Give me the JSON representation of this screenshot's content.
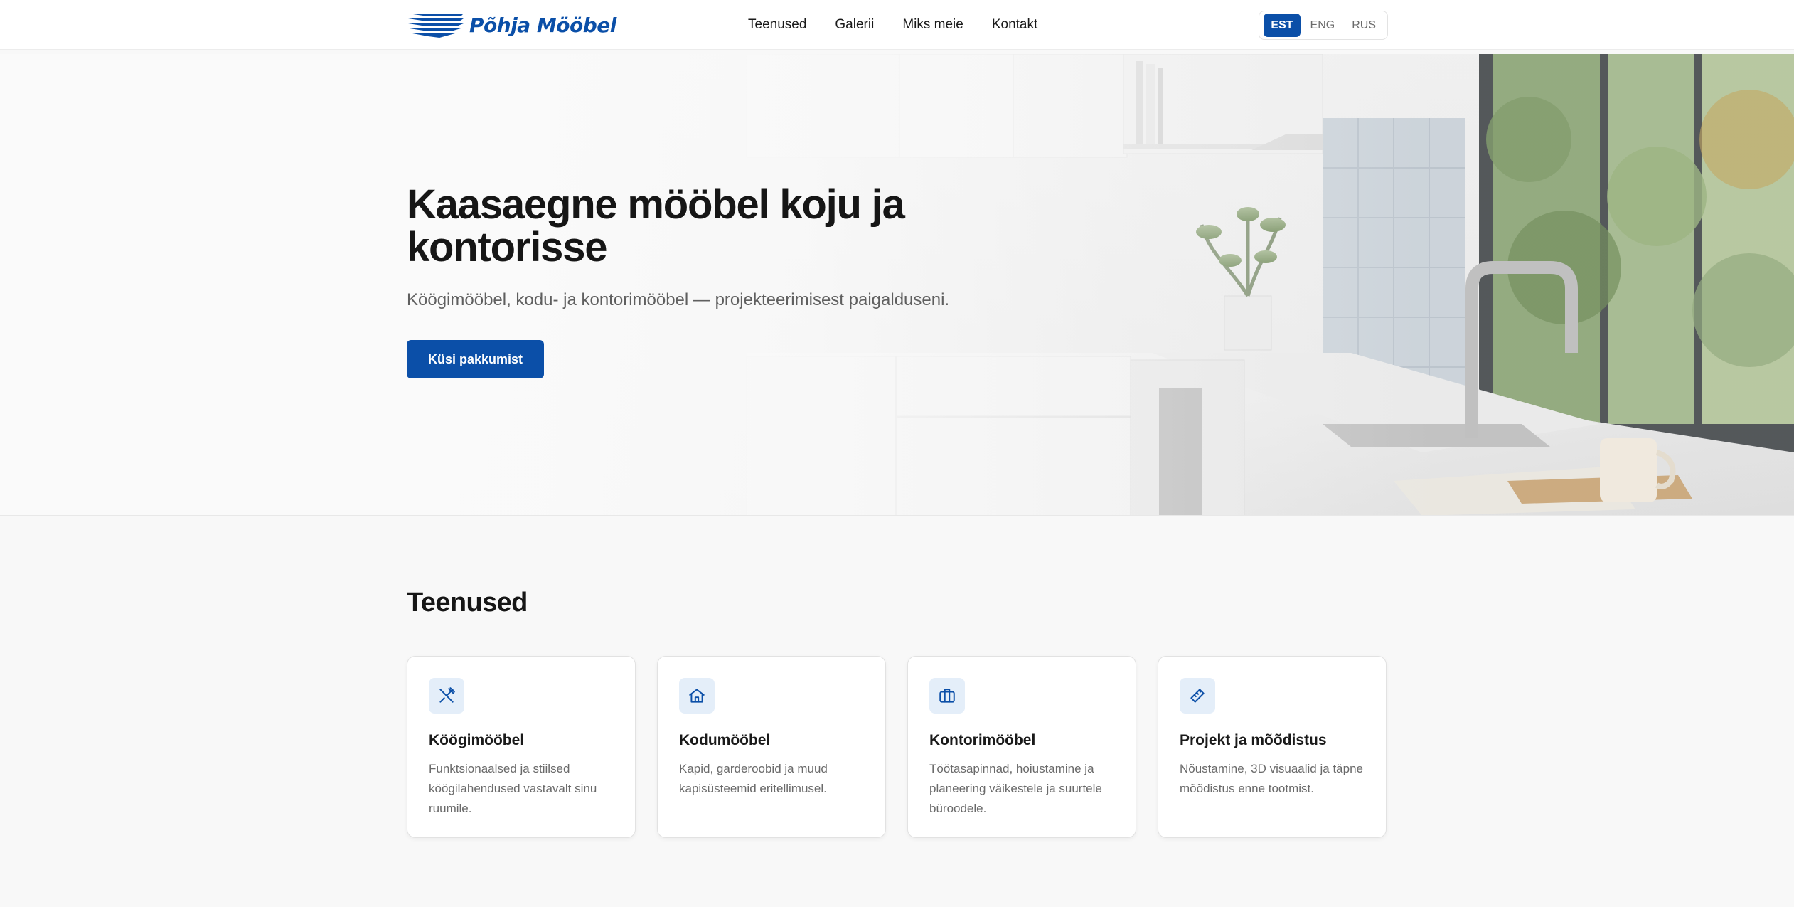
{
  "brand": {
    "name": "Põhja Mööbel",
    "color": "#0b4fa8"
  },
  "nav": {
    "links": [
      "Teenused",
      "Galerii",
      "Miks meie",
      "Kontakt"
    ]
  },
  "languages": {
    "options": [
      "EST",
      "ENG",
      "RUS"
    ],
    "selected": "EST"
  },
  "hero": {
    "title": "Kaasaegne mööbel koju ja kontorisse",
    "subtitle": "Köögimööbel, kodu- ja kontorimööbel — projekteerimisest paigalduseni.",
    "cta_label": "Küsi pakkumist",
    "background": "kitchen-photo"
  },
  "services": {
    "title": "Teenused",
    "cards": [
      {
        "icon": "utensils-icon",
        "title": "Köögimööbel",
        "desc": "Funktsionaalsed ja stiilsed köögilahendused vastavalt sinu ruumile."
      },
      {
        "icon": "home-icon",
        "title": "Kodumööbel",
        "desc": "Kapid, garderoobid ja muud kapisüsteemid eritellimusel."
      },
      {
        "icon": "briefcase-icon",
        "title": "Kontorimööbel",
        "desc": "Töötasapinnad, hoiustamine ja planeering väikestele ja suurtele büroodele."
      },
      {
        "icon": "ruler-icon",
        "title": "Projekt ja mõõdistus",
        "desc": "Nõustamine, 3D visuaalid ja täpne mõõdistus enne tootmist."
      }
    ]
  }
}
